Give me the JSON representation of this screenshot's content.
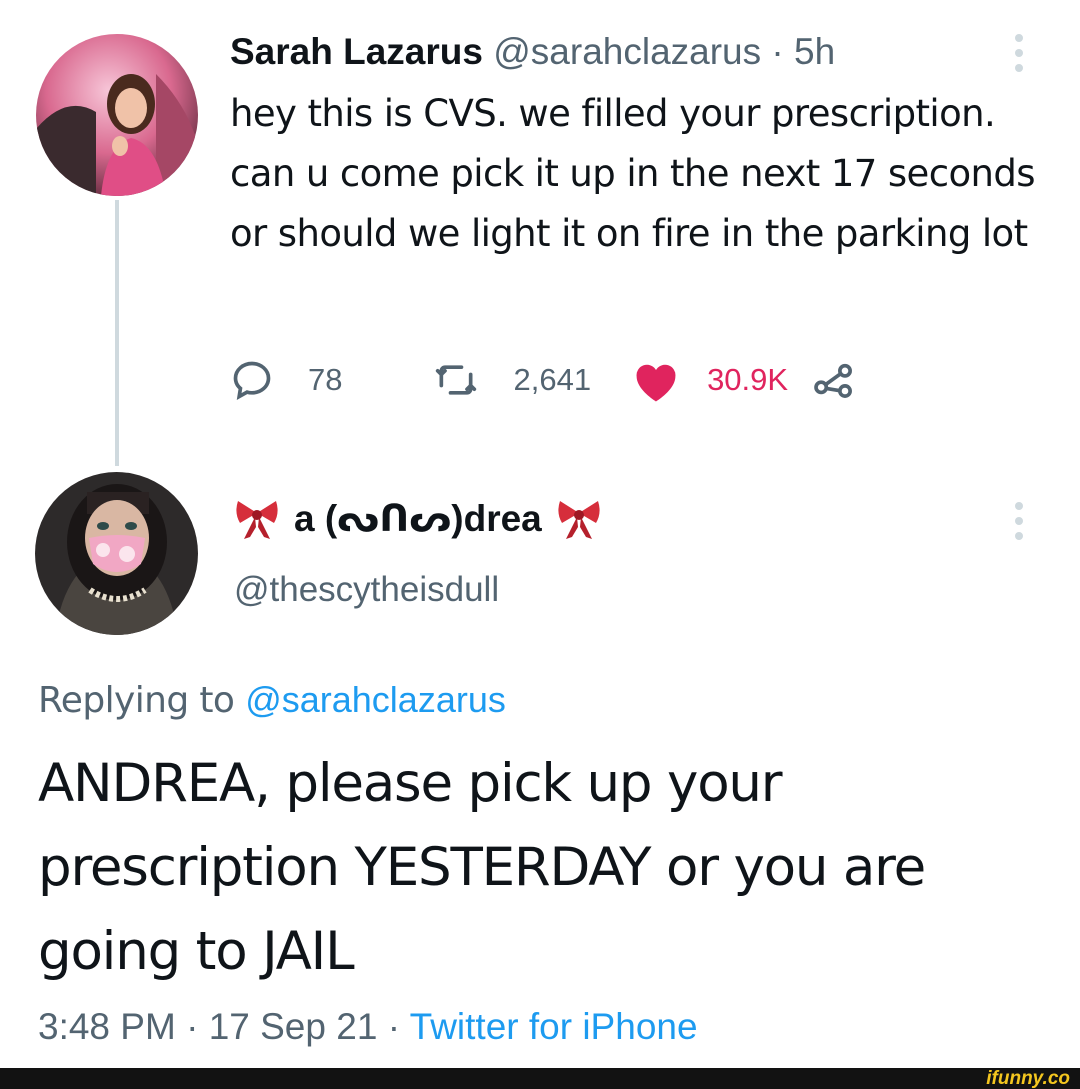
{
  "tweet": {
    "author_name": "Sarah Lazarus",
    "author_handle": "@sarahclazarus",
    "separator": "·",
    "time_ago": "5h",
    "text": "hey this is CVS. we filled your prescription. can u come pick it up in the next 17 seconds or should we light it on fire in the parking lot",
    "replies": "78",
    "retweets": "2,641",
    "likes": "30.9K",
    "like_color": "#e0245e"
  },
  "reply": {
    "author_name": "a (ᔓᑎᔕ)drea",
    "author_handle": "@thescytheisdull",
    "replying_label": "Replying to",
    "replying_handle": "@sarahclazarus",
    "text": "ANDREA, please pick up your prescription YESTERDAY or you are going to JAIL",
    "time": "3:48 PM",
    "date": "17 Sep 21",
    "separator": "·",
    "source": "Twitter for iPhone"
  },
  "watermark": {
    "text": "ifunny.co"
  },
  "colors": {
    "link": "#1d9bf0",
    "muted": "#536471",
    "text": "#0f1419"
  }
}
